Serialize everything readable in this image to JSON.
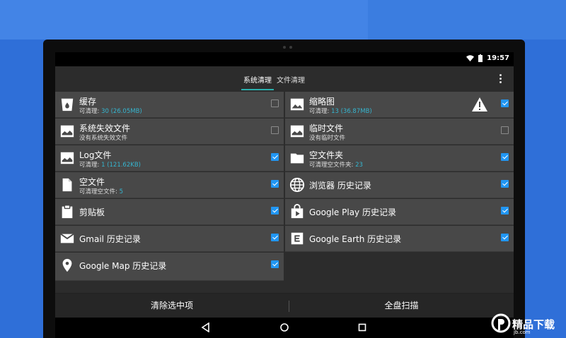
{
  "status": {
    "time": "19:57"
  },
  "tabs": [
    {
      "label": "系统清理",
      "active": true
    },
    {
      "label": "文件清理",
      "active": false
    }
  ],
  "left_items": [
    {
      "title": "缓存",
      "sub_prefix": "可清理: ",
      "sub_num": "30 (26.05MB)",
      "checked": false,
      "icon": "trash-icon"
    },
    {
      "title": "系统失效文件",
      "sub_prefix": "没有系统失效文件",
      "sub_num": "",
      "checked": false,
      "icon": "broken-image-icon"
    },
    {
      "title": "Log文件",
      "sub_prefix": "可清理: ",
      "sub_num": "1 (121.62KB)",
      "checked": true,
      "icon": "broken-image-icon"
    },
    {
      "title": "空文件",
      "sub_prefix": "可清理空文件: ",
      "sub_num": "5",
      "checked": true,
      "icon": "file-icon"
    },
    {
      "title": "剪贴板",
      "checked": true,
      "icon": "clipboard-icon"
    },
    {
      "title": "Gmail 历史记录",
      "checked": true,
      "icon": "mail-icon"
    },
    {
      "title": "Google Map 历史记录",
      "checked": true,
      "icon": "map-pin-icon"
    }
  ],
  "right_items": [
    {
      "title": "缩略图",
      "sub_prefix": "可清理: ",
      "sub_num": "13 (36.87MB)",
      "checked": true,
      "icon": "image-icon",
      "warning": true
    },
    {
      "title": "临时文件",
      "sub_prefix": "没有临时文件",
      "sub_num": "",
      "checked": false,
      "icon": "broken-image-icon"
    },
    {
      "title": "空文件夹",
      "sub_prefix": "可清理空文件夹: ",
      "sub_num": "23",
      "checked": true,
      "icon": "folder-icon"
    },
    {
      "title": "浏览器 历史记录",
      "checked": true,
      "icon": "globe-icon"
    },
    {
      "title": "Google Play 历史记录",
      "checked": true,
      "icon": "play-store-icon"
    },
    {
      "title": "Google Earth 历史记录",
      "checked": true,
      "icon": "earth-letter-icon"
    }
  ],
  "bottom": {
    "clear_label": "清除选中项",
    "scan_label": "全盘扫描"
  },
  "watermark": {
    "text": "精品下载",
    "sub": "jb.com"
  },
  "colors": {
    "accent": "#2bb0ad",
    "checkbox": "#2196f3",
    "count": "#35b5cf"
  }
}
